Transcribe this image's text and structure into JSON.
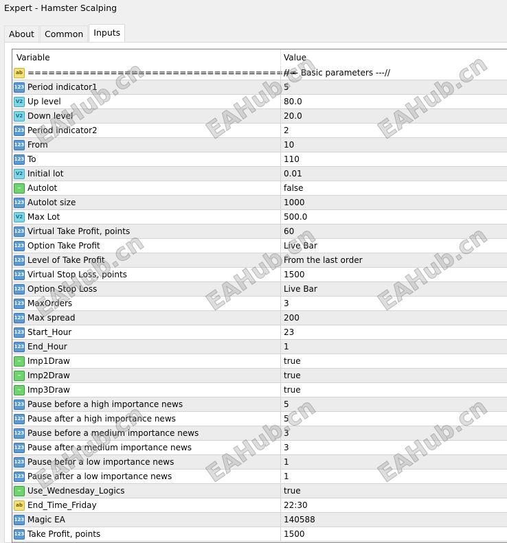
{
  "window": {
    "title": "Expert - Hamster Scalping"
  },
  "tabs": [
    {
      "label": "About"
    },
    {
      "label": "Common"
    },
    {
      "label": "Inputs",
      "active": true
    }
  ],
  "table": {
    "headers": {
      "variable": "Variable",
      "value": "Value"
    },
    "rows": [
      {
        "type": "string",
        "name": "=======================================",
        "value": "//--- Basic parameters ---//"
      },
      {
        "type": "int",
        "name": "Period indicator1",
        "value": "5"
      },
      {
        "type": "double",
        "name": "Up level",
        "value": "80.0"
      },
      {
        "type": "double",
        "name": "Down level",
        "value": "20.0"
      },
      {
        "type": "int",
        "name": "Period indicator2",
        "value": "2"
      },
      {
        "type": "int",
        "name": "From",
        "value": "10"
      },
      {
        "type": "int",
        "name": "To",
        "value": "110"
      },
      {
        "type": "double",
        "name": "Initial lot",
        "value": "0.01"
      },
      {
        "type": "bool",
        "name": "Autolot",
        "value": "false"
      },
      {
        "type": "int",
        "name": "Autolot size",
        "value": "1000"
      },
      {
        "type": "double",
        "name": "Max Lot",
        "value": "500.0"
      },
      {
        "type": "int",
        "name": "Virtual Take Profit, points",
        "value": "60"
      },
      {
        "type": "int",
        "name": "Option Take Profit",
        "value": "Live Bar"
      },
      {
        "type": "int",
        "name": "Level of Take Profit",
        "value": "From the last order"
      },
      {
        "type": "int",
        "name": "Virtual Stop Loss, points",
        "value": "1500"
      },
      {
        "type": "int",
        "name": "Option Stop Loss",
        "value": "Live Bar"
      },
      {
        "type": "int",
        "name": "MaxOrders",
        "value": "3"
      },
      {
        "type": "int",
        "name": "Max spread",
        "value": "200"
      },
      {
        "type": "int",
        "name": "Start_Hour",
        "value": "23"
      },
      {
        "type": "int",
        "name": "End_Hour",
        "value": "1"
      },
      {
        "type": "bool",
        "name": "Imp1Draw",
        "value": "true"
      },
      {
        "type": "bool",
        "name": "Imp2Draw",
        "value": "true"
      },
      {
        "type": "bool",
        "name": "Imp3Draw",
        "value": "true"
      },
      {
        "type": "int",
        "name": "Pause before a high importance news",
        "value": "5"
      },
      {
        "type": "int",
        "name": "Pause after a high importance news",
        "value": "5"
      },
      {
        "type": "int",
        "name": "Pause before a medium importance news",
        "value": "3"
      },
      {
        "type": "int",
        "name": "Pause after a medium importance news",
        "value": "3"
      },
      {
        "type": "int",
        "name": "Pause befor a low importance news",
        "value": "1"
      },
      {
        "type": "int",
        "name": "Pause after a low importance news",
        "value": "1"
      },
      {
        "type": "bool",
        "name": "Use_Wednesday_Logics",
        "value": "true"
      },
      {
        "type": "string",
        "name": "End_Time_Friday",
        "value": "22:30"
      },
      {
        "type": "int",
        "name": "Magic EA",
        "value": "140588"
      },
      {
        "type": "int",
        "name": "Take Profit, points",
        "value": "1500"
      }
    ]
  },
  "icons": {
    "int": "123",
    "double": "V2",
    "string": "ab",
    "bool": "~"
  },
  "watermark": "EAHub.cn"
}
